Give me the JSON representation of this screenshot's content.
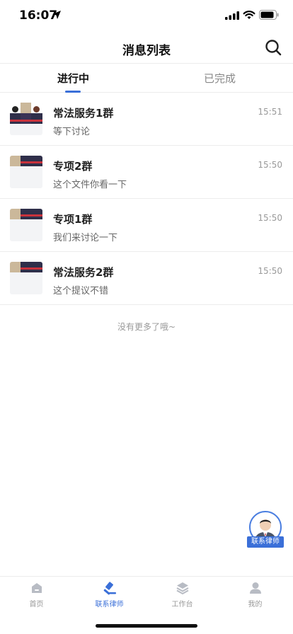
{
  "status_bar": {
    "time": "16:07"
  },
  "header": {
    "title": "消息列表"
  },
  "tabs": [
    {
      "label": "进行中",
      "active": true
    },
    {
      "label": "已完成",
      "active": false
    }
  ],
  "chats": [
    {
      "name": "常法服务1群",
      "preview": "等下讨论",
      "time": "15:51"
    },
    {
      "name": "专项2群",
      "preview": "这个文件你看一下",
      "time": "15:50"
    },
    {
      "name": "专项1群",
      "preview": "我们来讨论一下",
      "time": "15:50"
    },
    {
      "name": "常法服务2群",
      "preview": "这个提议不错",
      "time": "15:50"
    }
  ],
  "list_end_text": "没有更多了哦~",
  "float_button": {
    "label": "联系律师"
  },
  "bottom_nav": [
    {
      "label": "首页",
      "icon": "home-icon",
      "active": false
    },
    {
      "label": "联系律师",
      "icon": "gavel-icon",
      "active": true
    },
    {
      "label": "工作台",
      "icon": "layers-icon",
      "active": false
    },
    {
      "label": "我的",
      "icon": "user-icon",
      "active": false
    }
  ],
  "colors": {
    "accent": "#3a6fd8",
    "divider": "#ececec",
    "muted": "#999999"
  }
}
